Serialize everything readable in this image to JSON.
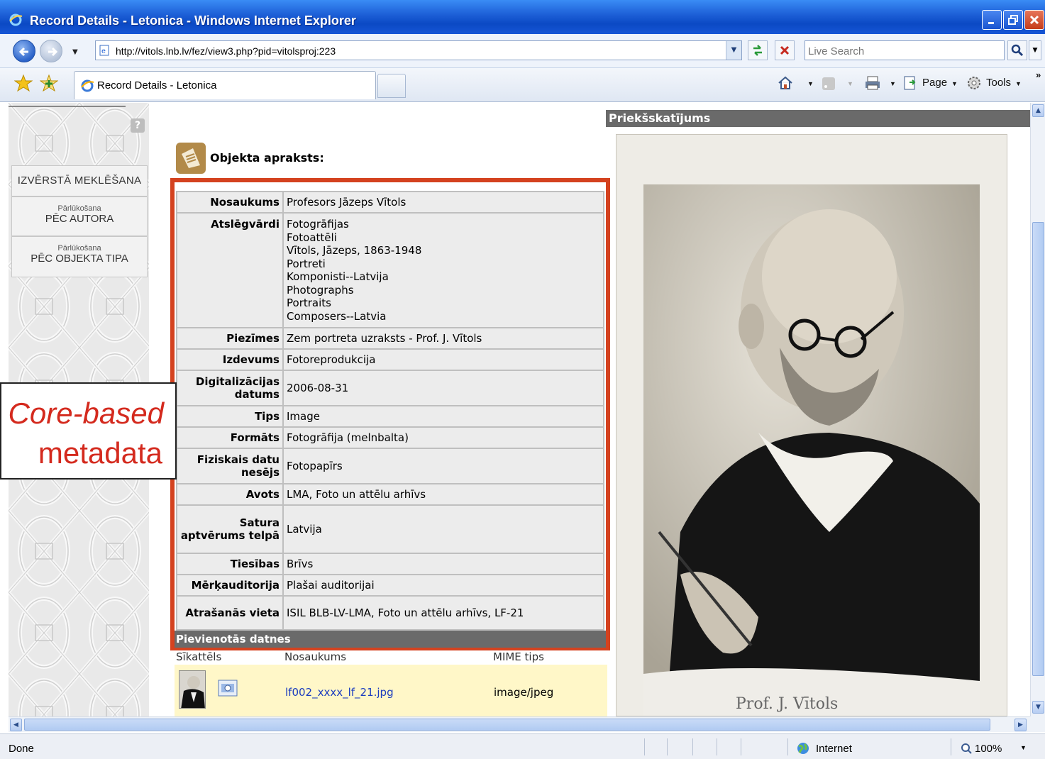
{
  "window": {
    "title": "Record Details - Letonica - Windows Internet Explorer",
    "address": "http://vitols.lnb.lv/fez/view3.php?pid=vitolsproj:223",
    "search_placeholder": "Live Search"
  },
  "tabs": [
    {
      "label": "Record Details - Letonica"
    }
  ],
  "commands": {
    "page": "Page",
    "tools": "Tools"
  },
  "sidebar": {
    "advanced_search": "IZVĒRSTĀ MEKLĒŠANA",
    "items": [
      {
        "small": "Pārlūkošana",
        "big": "PĒC AUTORA"
      },
      {
        "small": "Pārlūkošana",
        "big": "PĒC OBJEKTA TIPA"
      }
    ],
    "help_glyph": "?"
  },
  "object": {
    "heading": "Objekta apraksts:",
    "fields": [
      {
        "key": "Nosaukums",
        "value": "Profesors Jāzeps Vītols"
      },
      {
        "key": "Atslēgvārdi",
        "values": [
          "Fotogrāfijas",
          "Fotoattēli",
          "Vītols, Jāzeps, 1863-1948",
          "Portreti",
          "Komponisti--Latvija",
          "Photographs",
          "Portraits",
          "Composers--Latvia"
        ]
      },
      {
        "key": "Piezīmes",
        "value": "Zem portreta uzraksts - Prof. J. Vītols"
      },
      {
        "key": "Izdevums",
        "value": "Fotoreprodukcija"
      },
      {
        "key": "Digitalizācijas datums",
        "value": "2006-08-31"
      },
      {
        "key": "Tips",
        "value": "Image"
      },
      {
        "key": "Formāts",
        "value": "Fotogrāfija (melnbalta)"
      },
      {
        "key": "Fiziskais datu nesējs",
        "value": "Fotopapīrs"
      },
      {
        "key": "Avots",
        "value": "LMA, Foto un attēlu arhīvs"
      },
      {
        "key": "Satura aptvērums telpā",
        "value": "Latvija"
      },
      {
        "key": "Tiesības",
        "value": "Brīvs"
      },
      {
        "key": "Mērķauditorija",
        "value": "Plašai auditorijai"
      },
      {
        "key": "Atrašanās vieta",
        "value": "ISIL BLB-LV-LMA, Foto un attēlu arhīvs, LF-21"
      }
    ]
  },
  "attachments": {
    "heading": "Pievienotās datnes",
    "columns": [
      "Sīkattēls",
      "Nosaukums",
      "MIME tips"
    ],
    "rows": [
      {
        "name": "lf002_xxxx_lf_21.jpg",
        "mime": "image/jpeg"
      }
    ]
  },
  "preview": {
    "heading": "Priekšskatījums",
    "caption": "Prof. J. Vītols"
  },
  "annotation": {
    "line1": "Core-based",
    "line2": "metadata",
    "color": "#d42a1e"
  },
  "status": {
    "text": "Done",
    "zone": "Internet",
    "zoom": "100%"
  },
  "colors": {
    "title_bar": "#1f62d9",
    "highlight_frame": "#d4421f",
    "section_header": "#6a6a6a",
    "attachment_row": "#fff7c8",
    "link": "#1a3bbf"
  }
}
